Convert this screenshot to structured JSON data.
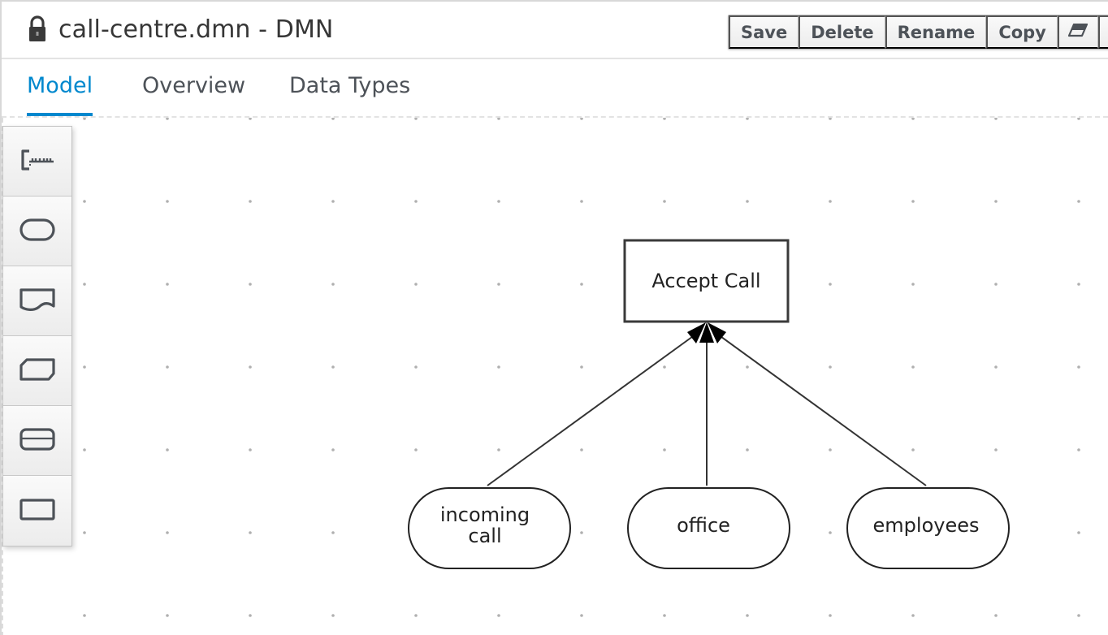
{
  "header": {
    "title": "call-centre.dmn - DMN",
    "lock_icon": "lock-icon",
    "toolbar": {
      "save_label": "Save",
      "delete_label": "Delete",
      "rename_label": "Rename",
      "copy_label": "Copy",
      "eraser_icon": "eraser-icon",
      "play_icon": "play-icon",
      "more_icon": "kebab-icon"
    }
  },
  "tabs": [
    {
      "label": "Model",
      "active": true
    },
    {
      "label": "Overview",
      "active": false
    },
    {
      "label": "Data Types",
      "active": false
    }
  ],
  "palette": {
    "items": [
      {
        "name": "annotation-tool",
        "icon": "text-annotation-icon"
      },
      {
        "name": "input-data-tool",
        "icon": "input-data-icon"
      },
      {
        "name": "knowledge-source-tool",
        "icon": "knowledge-source-icon"
      },
      {
        "name": "business-knowledge-model-tool",
        "icon": "bkm-icon"
      },
      {
        "name": "decision-service-tool",
        "icon": "decision-service-icon"
      },
      {
        "name": "decision-tool",
        "icon": "decision-icon"
      }
    ]
  },
  "diagram": {
    "decision": {
      "label": "Accept Call"
    },
    "inputs": [
      {
        "label_lines": [
          "incoming",
          "call"
        ]
      },
      {
        "label_lines": [
          "office"
        ]
      },
      {
        "label_lines": [
          "employees"
        ]
      }
    ],
    "colors": {
      "accent": "#0088ce",
      "node_stroke": "#333333",
      "grid_dot": "#b0b0b0"
    }
  }
}
